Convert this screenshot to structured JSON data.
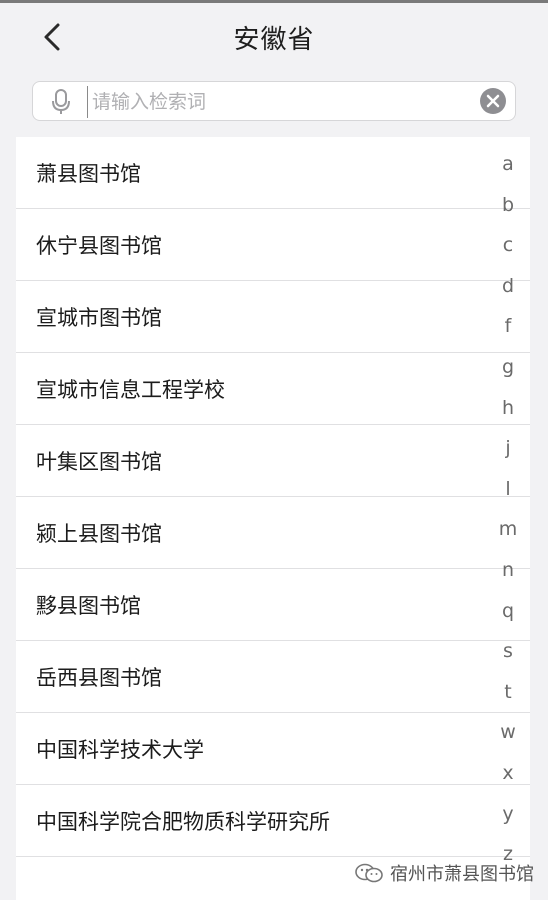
{
  "header": {
    "title": "安徽省",
    "back_icon": "chevron-left-icon"
  },
  "search": {
    "placeholder": "请输入检索词",
    "value": "",
    "mic_icon": "microphone-icon",
    "clear_icon": "clear-circle-icon"
  },
  "library_list": {
    "items": [
      {
        "label": "萧县图书馆"
      },
      {
        "label": "休宁县图书馆"
      },
      {
        "label": "宣城市图书馆"
      },
      {
        "label": "宣城市信息工程学校"
      },
      {
        "label": "叶集区图书馆"
      },
      {
        "label": "颍上县图书馆"
      },
      {
        "label": "黟县图书馆"
      },
      {
        "label": "岳西县图书馆"
      },
      {
        "label": "中国科学技术大学"
      },
      {
        "label": "中国科学院合肥物质科学研究所"
      }
    ]
  },
  "index_bar": {
    "letters": [
      "a",
      "b",
      "c",
      "d",
      "f",
      "g",
      "h",
      "j",
      "l",
      "m",
      "n",
      "q",
      "s",
      "t",
      "w",
      "x",
      "y",
      "z"
    ]
  },
  "watermark": {
    "text": "宿州市萧县图书馆",
    "icon": "wechat-icon"
  },
  "colors": {
    "background": "#f2f2f4",
    "list_background": "#ffffff",
    "text": "#1c1c1c",
    "placeholder": "#b0b0b3",
    "index_letter": "#6a6a6a"
  }
}
